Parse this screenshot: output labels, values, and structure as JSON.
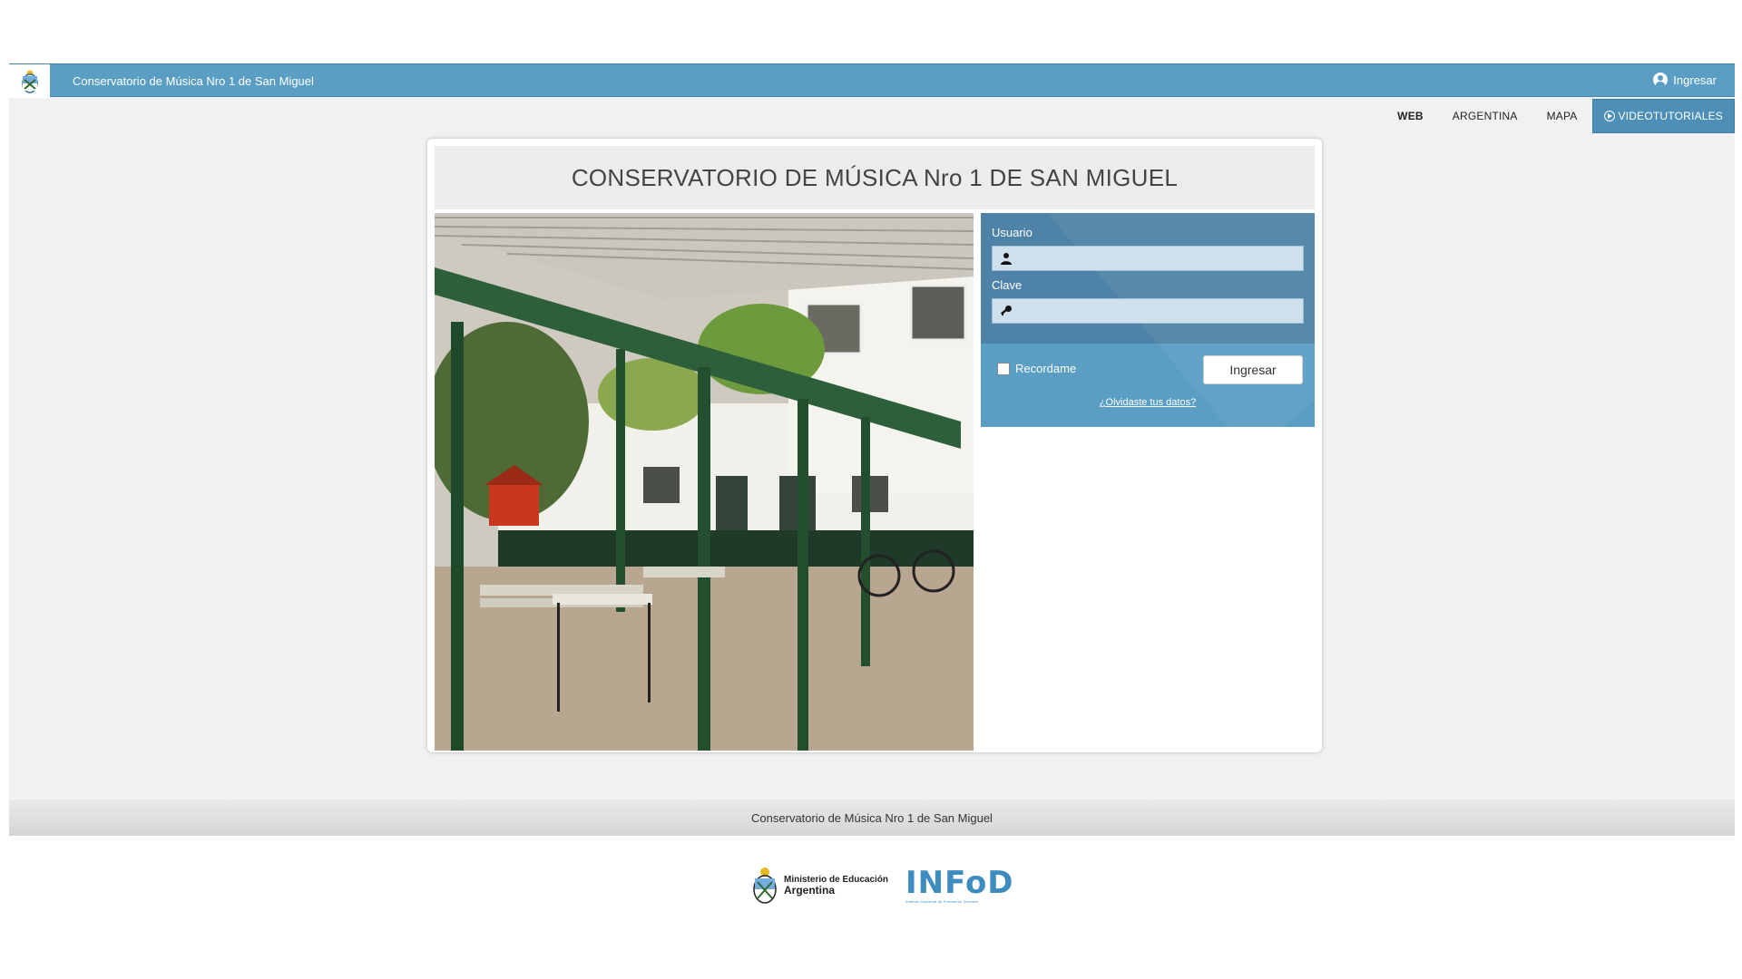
{
  "header": {
    "site_title": "Conservatorio de Música Nro 1 de San Miguel",
    "login_label": "Ingresar"
  },
  "nav": {
    "items": [
      {
        "label": "WEB",
        "active": true
      },
      {
        "label": "ARGENTINA",
        "active": false
      },
      {
        "label": "MAPA",
        "active": false
      }
    ],
    "video_label": "VIDEOTUTORIALES"
  },
  "card": {
    "title": "CONSERVATORIO DE MÚSICA Nro 1 DE SAN MIGUEL"
  },
  "login_form": {
    "user_label": "Usuario",
    "user_value": "",
    "password_label": "Clave",
    "password_value": "",
    "remember_label": "Recordame",
    "remember_checked": false,
    "submit_label": "Ingresar",
    "forgot_label": "¿Olvidaste tus datos?"
  },
  "footer": {
    "text": "Conservatorio de Música Nro 1 de San Miguel",
    "ministry_line1": "Ministerio de Educación",
    "ministry_line2": "Argentina",
    "infod_logo": "INFoD",
    "infod_subtitle": "Instituto Nacional de Formación Docente"
  },
  "colors": {
    "brand_blue": "#5b9ec4",
    "dark_blue": "#4e83a7"
  }
}
